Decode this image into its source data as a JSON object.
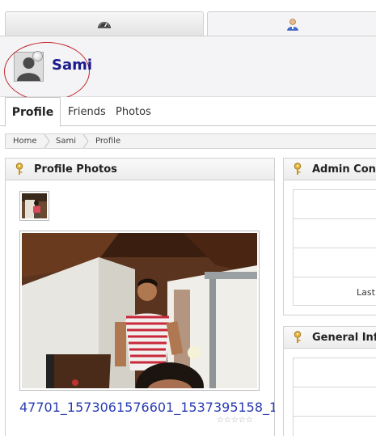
{
  "top_tabs": [
    {
      "icon": "dashboard-icon",
      "active": false
    },
    {
      "icon": "user-icon",
      "active": true
    }
  ],
  "header": {
    "user_name": "Sami",
    "avatar_icon": "default-avatar-icon",
    "status_icon": "online-status-icon"
  },
  "sub_tabs": [
    {
      "label": "Profile",
      "active": true
    },
    {
      "label": "Friends",
      "active": false
    },
    {
      "label": "Photos",
      "active": false
    }
  ],
  "breadcrumb": [
    "Home",
    "Sami",
    "Profile"
  ],
  "profile_photos": {
    "title": "Profile Photos",
    "photo_title": "47701_1573061576601_1537395158_1",
    "rating_stars": "☆☆☆☆☆"
  },
  "admin_panel": {
    "title": "Admin Cont",
    "row_label": "Last"
  },
  "general_panel": {
    "title": "General Inf"
  },
  "colors": {
    "name": "#1a1a8c",
    "link": "#2a3cb4",
    "annotation_circle": "#c1272d",
    "header_bg": "#f4f4f6"
  }
}
